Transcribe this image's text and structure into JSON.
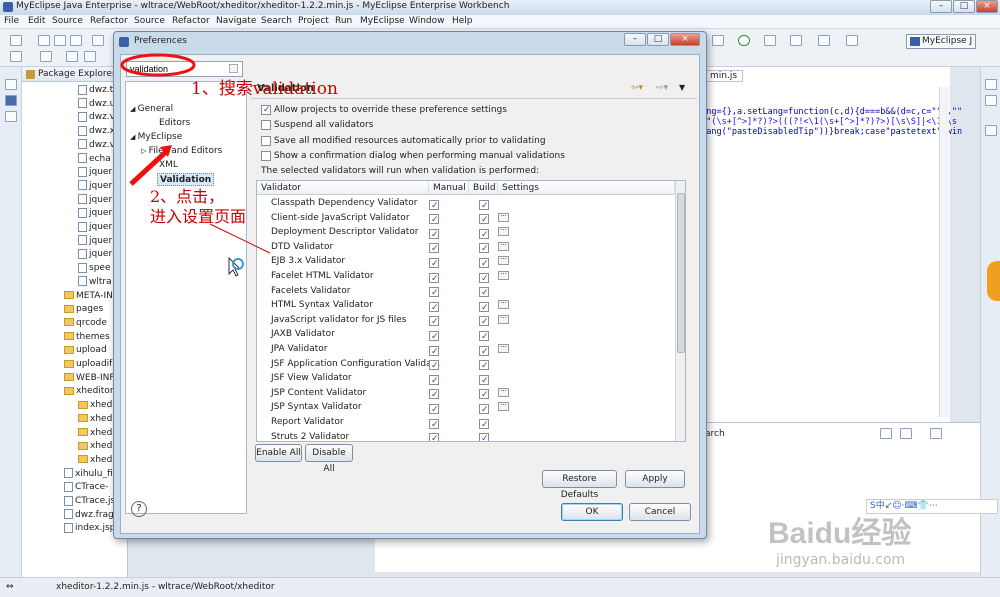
{
  "window": {
    "title": "MyEclipse Java Enterprise - wltrace/WebRoot/xheditor/xheditor-1.2.2.min.js - MyEclipse Enterprise Workbench",
    "min": "–",
    "max": "□",
    "close": "×"
  },
  "menu": [
    "File",
    "Edit",
    "Source",
    "Refactor",
    "Source",
    "Refactor",
    "Navigate",
    "Search",
    "Project",
    "Run",
    "MyEclipse",
    "Window",
    "Help"
  ],
  "toolbar": {
    "perspective_label": "MyEclipse J"
  },
  "package_explorer": {
    "title": "Package Explorer",
    "items": [
      "dwz.t",
      "dwz.u",
      "dwz.v",
      "dwz.x",
      "dwz.v",
      "echa",
      "jquer",
      "jquer",
      "jquer",
      "jquer",
      "jquer",
      "jquer",
      "jquer",
      "spee",
      "wltra",
      "META-IN",
      "pages",
      "qrcode",
      "themes",
      "upload",
      "uploadif",
      "WEB-INF",
      "xheditor",
      "xhedi",
      "xhedi",
      "xhedi",
      "xhedi",
      "xhedi",
      "xihulu_fil",
      "CTrace-",
      "CTrace.jsp",
      "dwz.frag.xml",
      "index.jsp"
    ]
  },
  "editor": {
    "tab": "min.js",
    "lines": [
      "Lang={},a.setLang=function(c,d){d===b&&(d=c,c=\"\"),\"\"",
      "an\"(\\s+[^>]*?)?>(((?!<\\1(\\s+[^>]*?)?>)[\\s\\S]|<\\1(\\s",
      "tLang(\"pasteDisabledTip\"))}break;case\"pastetext\":win"
    ],
    "search_tab": "arch"
  },
  "status_bar": {
    "path": "xheditor-1.2.2.min.js - wltrace/WebRoot/xheditor"
  },
  "dialog": {
    "title": "Preferences",
    "filter_value": "validation",
    "tree": {
      "general": "General",
      "editors": "Editors",
      "myeclipse": "MyEclipse",
      "files_editors": "Files and Editors",
      "xml": "XML",
      "validation": "Validation"
    },
    "page_title": "Validation",
    "options": [
      {
        "label": "Allow projects to override these preference settings",
        "checked": true
      },
      {
        "label": "Suspend all validators",
        "checked": false
      },
      {
        "label": "Save all modified resources automatically prior to validating",
        "checked": false
      },
      {
        "label": "Show a confirmation dialog when performing manual validations",
        "checked": false
      }
    ],
    "run_note": "The selected validators will run when validation is performed:",
    "table": {
      "headers": [
        "Validator",
        "Manual",
        "Build",
        "Settings"
      ],
      "rows": [
        {
          "name": "Classpath Dependency Validator",
          "manual": true,
          "build": true,
          "settings": false
        },
        {
          "name": "Client-side JavaScript Validator",
          "manual": true,
          "build": true,
          "settings": true
        },
        {
          "name": "Deployment Descriptor Validator",
          "manual": true,
          "build": true,
          "settings": true
        },
        {
          "name": "DTD Validator",
          "manual": true,
          "build": true,
          "settings": true
        },
        {
          "name": "EJB 3.x Validator",
          "manual": true,
          "build": true,
          "settings": true
        },
        {
          "name": "Facelet HTML Validator",
          "manual": true,
          "build": true,
          "settings": true
        },
        {
          "name": "Facelets Validator",
          "manual": true,
          "build": true,
          "settings": false
        },
        {
          "name": "HTML Syntax Validator",
          "manual": true,
          "build": true,
          "settings": true
        },
        {
          "name": "JavaScript validator for JS files",
          "manual": true,
          "build": true,
          "settings": true
        },
        {
          "name": "JAXB Validator",
          "manual": true,
          "build": true,
          "settings": false
        },
        {
          "name": "JPA Validator",
          "manual": true,
          "build": true,
          "settings": true
        },
        {
          "name": "JSF Application Configuration Valida...",
          "manual": true,
          "build": true,
          "settings": false
        },
        {
          "name": "JSF View Validator",
          "manual": true,
          "build": true,
          "settings": false
        },
        {
          "name": "JSP Content Validator",
          "manual": true,
          "build": true,
          "settings": true
        },
        {
          "name": "JSP Syntax Validator",
          "manual": true,
          "build": true,
          "settings": true
        },
        {
          "name": "Report Validator",
          "manual": true,
          "build": true,
          "settings": false
        },
        {
          "name": "Struts 2 Validator",
          "manual": true,
          "build": true,
          "settings": false
        }
      ]
    },
    "enable_all": "Enable All",
    "disable_all": "Disable All",
    "restore_defaults": "Restore Defaults",
    "apply": "Apply",
    "ok": "OK",
    "cancel": "Cancel",
    "help": "?"
  },
  "annotations": {
    "step1": "1、搜索validation",
    "step2_line1": "2、点击，",
    "step2_line2": "进入设置页面"
  },
  "watermark": {
    "brand": "Baidu经验",
    "url": "jingyan.baidu.com",
    "ime": "S中↙☺·⌨👕⋯"
  },
  "colors": {
    "annotation": "#cc0000",
    "selection": "#3399ff",
    "dialog_frame": "#c9daea"
  }
}
